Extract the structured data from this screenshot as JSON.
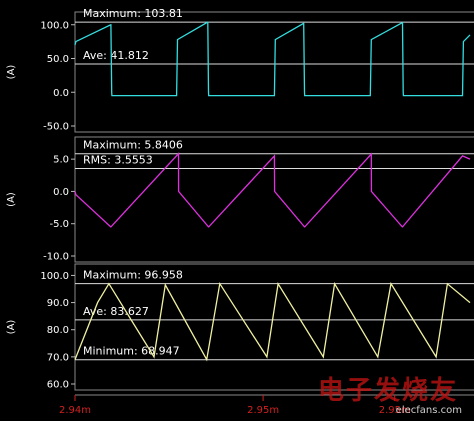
{
  "chart_data": [
    {
      "type": "line",
      "id": "panel1",
      "ylabel": "(A)",
      "ylim": [
        -50,
        110
      ],
      "yticks": [
        "100.0",
        "50.0",
        "0.0",
        "-50.0"
      ],
      "ytick_values": [
        100,
        50,
        0,
        -50
      ],
      "color": "#33dde0",
      "series": [
        {
          "x": [
            2.94,
            2.94005,
            2.9419,
            2.94191,
            2.94195,
            2.94196,
            2.9454,
            2.94545,
            2.94705,
            2.94706,
            2.9471,
            2.94711,
            2.9506,
            2.95065,
            2.95215,
            2.95216,
            2.9522,
            2.95221,
            2.9557,
            2.95575,
            2.9574,
            2.95741,
            2.95745,
            2.95746,
            2.9606,
            2.96065,
            2.961
          ],
          "y": [
            70,
            75,
            100,
            100,
            0,
            -5,
            -5,
            78,
            103.81,
            103.81,
            0,
            -5,
            -5,
            78,
            102,
            102,
            0,
            -5,
            -5,
            78,
            103,
            103,
            0,
            -5,
            -5,
            75,
            85
          ]
        }
      ],
      "annotations": [
        {
          "label": "Maximum: ",
          "value": "103.81",
          "y": 103.81
        },
        {
          "label": "Ave: ",
          "value": "41.812",
          "y": 41.812
        }
      ]
    },
    {
      "type": "line",
      "id": "panel2",
      "ylabel": "(A)",
      "ylim": [
        -10,
        7.5
      ],
      "yticks": [
        "5.0",
        "0.0",
        "-5.0",
        "-10.0"
      ],
      "ytick_values": [
        5,
        0,
        -5,
        -10
      ],
      "color": "#e030e0",
      "series": [
        {
          "x": [
            2.94,
            2.94005,
            2.9419,
            2.94191,
            2.9455,
            2.94551,
            2.9471,
            2.94711,
            2.9506,
            2.95061,
            2.9522,
            2.95221,
            2.95575,
            2.95576,
            2.9574,
            2.95741,
            2.9606,
            2.961
          ],
          "y": [
            0,
            -0.5,
            -5.5,
            -5.5,
            5.84,
            0,
            -5.5,
            -5.5,
            5.5,
            0,
            -5.5,
            -5.5,
            5.8,
            0,
            -5.5,
            -5.5,
            5.5,
            5.0
          ]
        }
      ],
      "annotations": [
        {
          "label": "Maximum: ",
          "value": "5.8406",
          "y": 5.8406
        },
        {
          "label": "RMS: ",
          "value": "3.5553",
          "y": 3.5553
        }
      ]
    },
    {
      "type": "line",
      "id": "panel3",
      "ylabel": "(A)",
      "ylim": [
        60,
        102
      ],
      "yticks": [
        "100.0",
        "90.0",
        "80.0",
        "70.0",
        "60.0"
      ],
      "ytick_values": [
        100,
        90,
        80,
        70,
        60
      ],
      "color": "#f0f0a0",
      "series": [
        {
          "x": [
            2.94,
            2.9412,
            2.9418,
            2.9442,
            2.9448,
            2.947,
            2.9477,
            2.9502,
            2.9508,
            2.9532,
            2.9538,
            2.9561,
            2.9568,
            2.9592,
            2.9598,
            2.961
          ],
          "y": [
            69,
            90,
            96.958,
            70,
            96.5,
            69,
            96.958,
            70,
            96.9,
            70,
            96.9,
            70,
            96.958,
            70,
            96.9,
            90
          ]
        }
      ],
      "annotations": [
        {
          "label": "Maximum: ",
          "value": "96.958",
          "y": 96.958
        },
        {
          "label": "Ave: ",
          "value": "83.627",
          "y": 83.627
        },
        {
          "label": "Minimum: ",
          "value": "68.947",
          "y": 68.947
        }
      ]
    }
  ],
  "xaxis": {
    "xlim": [
      2.94,
      2.961
    ],
    "ticks": [
      {
        "label": "2.94m",
        "value": 2.94
      },
      {
        "label": "2.95m",
        "value": 2.95
      },
      {
        "label": "2.95m",
        "value": 2.957
      }
    ]
  },
  "watermark": {
    "cn": "电子发烧友",
    "en": "elecfans.com"
  }
}
